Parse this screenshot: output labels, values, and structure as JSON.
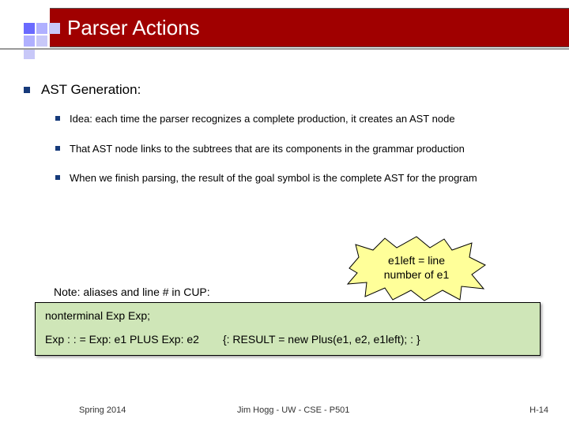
{
  "title": "Parser Actions",
  "heading": "AST Generation:",
  "subpoints": [
    "Idea: each time the parser recognizes a complete production, it creates an AST node",
    "That AST node links to the subtrees that are its components in the grammar production",
    "When we finish parsing, the result of the goal symbol is the complete AST for the program"
  ],
  "note": "Note: aliases and line # in CUP:",
  "burst": {
    "line1": "e1left = line",
    "line2": "number of e1"
  },
  "code": {
    "line1": "nonterminal Exp Exp;",
    "line2_left": "Exp : : = Exp: e1 PLUS Exp: e2",
    "line2_right": "{: RESULT = new Plus(e1, e2, e1left); : }"
  },
  "footer": {
    "left": "Spring 2014",
    "center": "Jim Hogg - UW - CSE - P501",
    "right": "H-14"
  }
}
